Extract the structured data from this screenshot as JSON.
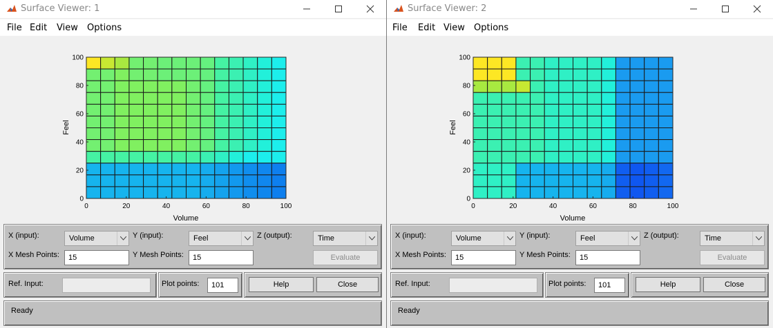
{
  "windows": [
    {
      "title": "Surface Viewer: 1",
      "menu": [
        "File",
        "Edit",
        "View",
        "Options"
      ],
      "plot": {
        "xlabel": "Volume",
        "ylabel": "Feel",
        "xticks": [
          "0",
          "20",
          "40",
          "60",
          "80",
          "100"
        ],
        "yticks": [
          "0",
          "20",
          "40",
          "60",
          "80",
          "100"
        ]
      },
      "controls": {
        "x_input_label": "X (input):",
        "x_input_value": "Volume",
        "y_input_label": "Y (input):",
        "y_input_value": "Feel",
        "z_output_label": "Z (output):",
        "z_output_value": "Time",
        "x_mesh_label": "X Mesh Points:",
        "x_mesh_value": "15",
        "y_mesh_label": "Y Mesh Points:",
        "y_mesh_value": "15",
        "evaluate_label": "Evaluate",
        "ref_input_label": "Ref. Input:",
        "ref_input_value": "",
        "plot_points_label": "Plot points:",
        "plot_points_value": "101",
        "help_label": "Help",
        "close_label": "Close",
        "status": "Ready"
      }
    },
    {
      "title": "Surface Viewer: 2",
      "menu": [
        "File",
        "Edit",
        "View",
        "Options"
      ],
      "plot": {
        "xlabel": "Volume",
        "ylabel": "Feel",
        "xticks": [
          "0",
          "20",
          "40",
          "60",
          "80",
          "100"
        ],
        "yticks": [
          "0",
          "20",
          "40",
          "60",
          "80",
          "100"
        ]
      },
      "controls": {
        "x_input_label": "X (input):",
        "x_input_value": "Volume",
        "y_input_label": "Y (input):",
        "y_input_value": "Feel",
        "z_output_label": "Z (output):",
        "z_output_value": "Time",
        "x_mesh_label": "X Mesh Points:",
        "x_mesh_value": "15",
        "y_mesh_label": "Y Mesh Points:",
        "y_mesh_value": "15",
        "evaluate_label": "Evaluate",
        "ref_input_label": "Ref. Input:",
        "ref_input_value": "",
        "plot_points_label": "Plot points:",
        "plot_points_value": "101",
        "help_label": "Help",
        "close_label": "Close",
        "status": "Ready"
      }
    }
  ],
  "chart_data": [
    {
      "type": "heatmap",
      "xlabel": "Volume",
      "ylabel": "Feel",
      "xlim": [
        0,
        100
      ],
      "ylim": [
        0,
        100
      ],
      "mesh_points": 14,
      "grid": true,
      "cell_colors_top_to_bottom": [
        [
          "#fde724",
          "#c7e832",
          "#a8e940",
          "#73f071",
          "#73f071",
          "#6cf078",
          "#6cf078",
          "#6cf078",
          "#65f17f",
          "#45f2a3",
          "#3bf0b2",
          "#2ff0c5",
          "#22f0da",
          "#1ceeec"
        ],
        [
          "#73f071",
          "#73f071",
          "#80f060",
          "#73f071",
          "#73f071",
          "#6cf078",
          "#6cf078",
          "#6cf078",
          "#65f17f",
          "#45f2a3",
          "#3bf0b2",
          "#2ff0c5",
          "#22f0da",
          "#1ceeec"
        ],
        [
          "#73f071",
          "#73f071",
          "#80f060",
          "#80f060",
          "#80f060",
          "#80f060",
          "#80f060",
          "#73f071",
          "#65f17f",
          "#45f2a3",
          "#3bf0b2",
          "#2ff0c5",
          "#22f0da",
          "#1ceeec"
        ],
        [
          "#73f071",
          "#73f071",
          "#80f060",
          "#80f060",
          "#80f060",
          "#80f060",
          "#80f060",
          "#73f071",
          "#65f17f",
          "#45f2a3",
          "#3bf0b2",
          "#2ff0c5",
          "#22f0da",
          "#1ceeec"
        ],
        [
          "#73f071",
          "#73f071",
          "#80f060",
          "#80f060",
          "#80f060",
          "#80f060",
          "#80f060",
          "#73f071",
          "#65f17f",
          "#45f2a3",
          "#3bf0b2",
          "#2ff0c5",
          "#22f0da",
          "#1ceeec"
        ],
        [
          "#73f071",
          "#73f071",
          "#80f060",
          "#80f060",
          "#80f060",
          "#80f060",
          "#80f060",
          "#73f071",
          "#65f17f",
          "#45f2a3",
          "#3bf0b2",
          "#2ff0c5",
          "#22f0da",
          "#1ceeec"
        ],
        [
          "#73f071",
          "#73f071",
          "#80f060",
          "#80f060",
          "#80f060",
          "#80f060",
          "#80f060",
          "#73f071",
          "#65f17f",
          "#45f2a3",
          "#3bf0b2",
          "#2ff0c5",
          "#22f0da",
          "#1ceeec"
        ],
        [
          "#73f071",
          "#73f071",
          "#80f060",
          "#80f060",
          "#80f060",
          "#80f060",
          "#80f060",
          "#73f071",
          "#65f17f",
          "#45f2a3",
          "#3bf0b2",
          "#2ff0c5",
          "#22f0da",
          "#1ceeec"
        ],
        [
          "#45f2a3",
          "#45f2a3",
          "#45f2a3",
          "#45f2a3",
          "#45f2a3",
          "#45f2a3",
          "#45f2a3",
          "#45f2a3",
          "#3bf0b2",
          "#2ff0c5",
          "#22f0da",
          "#1ceeec",
          "#1ceeec",
          "#1ceeec"
        ],
        [
          "#16b4ee",
          "#16b4ee",
          "#16b4ee",
          "#16b4ee",
          "#16b4ee",
          "#16b4ee",
          "#16b4ee",
          "#16b4ee",
          "#16acee",
          "#14a3ee",
          "#1299ee",
          "#108eee",
          "#1087ee",
          "#0e7fee"
        ],
        [
          "#16b4ee",
          "#16b4ee",
          "#16b4ee",
          "#16b4ee",
          "#16b4ee",
          "#16b4ee",
          "#16b4ee",
          "#16b4ee",
          "#16acee",
          "#14a3ee",
          "#1299ee",
          "#108eee",
          "#1087ee",
          "#0e7fee"
        ],
        [
          "#16b4ee",
          "#16b4ee",
          "#16b4ee",
          "#16b4ee",
          "#16b4ee",
          "#16b4ee",
          "#16b4ee",
          "#16b4ee",
          "#16acee",
          "#14a3ee",
          "#1299ee",
          "#108eee",
          "#1087ee",
          "#0e7fee"
        ]
      ]
    },
    {
      "type": "heatmap",
      "xlabel": "Volume",
      "ylabel": "Feel",
      "xlim": [
        0,
        100
      ],
      "ylim": [
        0,
        100
      ],
      "mesh_points": 14,
      "grid": true,
      "cell_colors_top_to_bottom": [
        [
          "#fde724",
          "#fde724",
          "#fde724",
          "#3bf0b2",
          "#3bf0b2",
          "#2ff0c5",
          "#2ff0c5",
          "#2ff0c5",
          "#2ff0c5",
          "#22f0da",
          "#1a9bf0",
          "#1a9bf0",
          "#1a9bf0",
          "#1a9bf0"
        ],
        [
          "#fde724",
          "#fde724",
          "#fde724",
          "#3bf0b2",
          "#3bf0b2",
          "#2ff0c5",
          "#2ff0c5",
          "#2ff0c5",
          "#2ff0c5",
          "#22f0da",
          "#1a9bf0",
          "#1a9bf0",
          "#1a9bf0",
          "#1a9bf0"
        ],
        [
          "#a8e940",
          "#a8e940",
          "#a8e940",
          "#c7e832",
          "#3bf0b2",
          "#2ff0c5",
          "#2ff0c5",
          "#2ff0c5",
          "#2ff0c5",
          "#22f0da",
          "#1a9bf0",
          "#1a9bf0",
          "#1a9bf0",
          "#1a9bf0"
        ],
        [
          "#3bf0b2",
          "#3bf0b2",
          "#3bf0b2",
          "#3bf0b2",
          "#3bf0b2",
          "#2ff0c5",
          "#2ff0c5",
          "#2ff0c5",
          "#2ff0c5",
          "#22f0da",
          "#1a9bf0",
          "#1a9bf0",
          "#1a9bf0",
          "#1a9bf0"
        ],
        [
          "#3bf0b2",
          "#3bf0b2",
          "#3bf0b2",
          "#3bf0b2",
          "#3bf0b2",
          "#2ff0c5",
          "#2ff0c5",
          "#2ff0c5",
          "#2ff0c5",
          "#22f0da",
          "#1a9bf0",
          "#1a9bf0",
          "#1a9bf0",
          "#1a9bf0"
        ],
        [
          "#3bf0b2",
          "#3bf0b2",
          "#3bf0b2",
          "#3bf0b2",
          "#3bf0b2",
          "#2ff0c5",
          "#2ff0c5",
          "#2ff0c5",
          "#2ff0c5",
          "#22f0da",
          "#1a9bf0",
          "#1a9bf0",
          "#1a9bf0",
          "#1a9bf0"
        ],
        [
          "#3bf0b2",
          "#3bf0b2",
          "#3bf0b2",
          "#3bf0b2",
          "#3bf0b2",
          "#2ff0c5",
          "#2ff0c5",
          "#2ff0c5",
          "#2ff0c5",
          "#22f0da",
          "#1a9bf0",
          "#1a9bf0",
          "#1a9bf0",
          "#1a9bf0"
        ],
        [
          "#3bf0b2",
          "#3bf0b2",
          "#3bf0b2",
          "#3bf0b2",
          "#3bf0b2",
          "#2ff0c5",
          "#2ff0c5",
          "#2ff0c5",
          "#2ff0c5",
          "#22f0da",
          "#1a9bf0",
          "#1a9bf0",
          "#1a9bf0",
          "#1a9bf0"
        ],
        [
          "#3bf0b2",
          "#3bf0b2",
          "#3bf0b2",
          "#3bf0b2",
          "#3bf0b2",
          "#2ff0c5",
          "#2ff0c5",
          "#2ff0c5",
          "#2ff0c5",
          "#22f0da",
          "#1a9bf0",
          "#1a9bf0",
          "#1a9bf0",
          "#1a9bf0"
        ],
        [
          "#2ff0c5",
          "#2ff0c5",
          "#2ff0c5",
          "#16b4ee",
          "#16b4ee",
          "#16b4ee",
          "#16b4ee",
          "#16b4ee",
          "#16b4ee",
          "#16acee",
          "#105ef0",
          "#0f57f0",
          "#105ef0",
          "#1268f0"
        ],
        [
          "#2ff0c5",
          "#2ff0c5",
          "#2ff0c5",
          "#16b4ee",
          "#16b4ee",
          "#16b4ee",
          "#16b4ee",
          "#16b4ee",
          "#16b4ee",
          "#16acee",
          "#105ef0",
          "#0f57f0",
          "#105ef0",
          "#1268f0"
        ],
        [
          "#2ff0c5",
          "#2ff0c5",
          "#2ff0c5",
          "#16b4ee",
          "#16b4ee",
          "#16b4ee",
          "#16b4ee",
          "#16b4ee",
          "#16b4ee",
          "#16acee",
          "#105ef0",
          "#0f57f0",
          "#105ef0",
          "#1268f0"
        ]
      ]
    }
  ]
}
